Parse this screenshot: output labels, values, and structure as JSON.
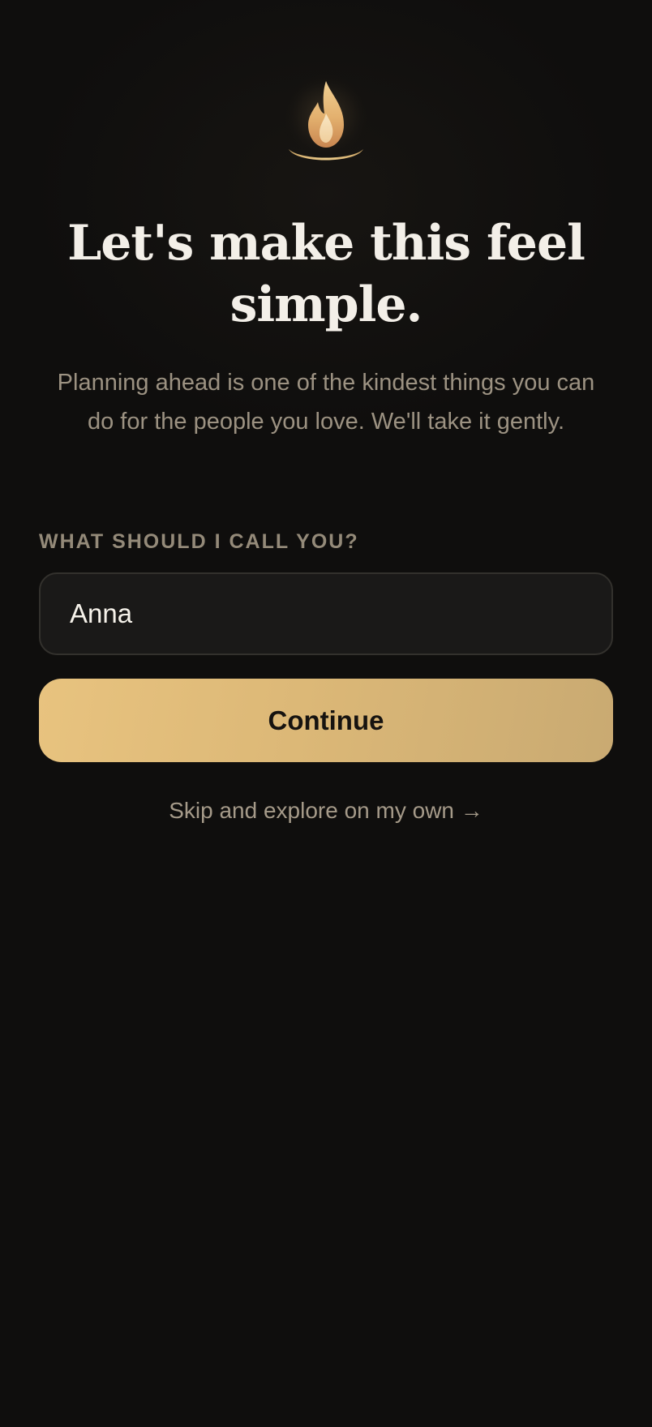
{
  "logo": {
    "icon": "flame-bowl-icon",
    "colors": {
      "flame": "#e9c27e",
      "inner": "#c98650",
      "glow": "#f8e7c6"
    }
  },
  "headline": "Let's make this feel simple.",
  "subtitle": "Planning ahead is one of the kindest things you can do for the people you love. We'll take it gently.",
  "name_field": {
    "label": "WHAT SHOULD I CALL YOU?",
    "value": "Anna"
  },
  "continue_button": {
    "label": "Continue",
    "color": "#e2bd7b"
  },
  "skip_link": {
    "label": "Skip and explore on my own →"
  },
  "theme": {
    "background": "#0f0e0d",
    "text": "#f3efe8",
    "muted": "#9c9282"
  }
}
